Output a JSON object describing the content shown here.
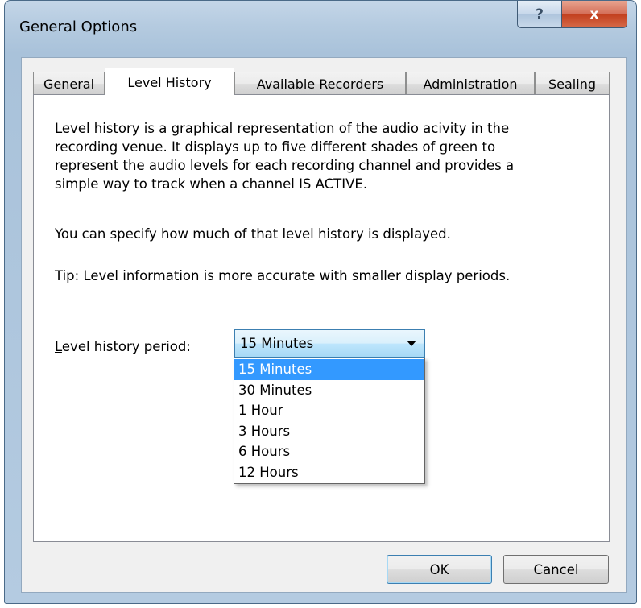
{
  "window": {
    "title": "General Options",
    "help_label": "?",
    "close_label": "x"
  },
  "tabs": [
    {
      "label": "General",
      "active": false
    },
    {
      "label": "Level History",
      "active": true
    },
    {
      "label": "Available Recorders",
      "active": false
    },
    {
      "label": "Administration",
      "active": false
    },
    {
      "label": "Sealing",
      "active": false
    }
  ],
  "panel": {
    "description_lines": [
      "Level history is a graphical representation of the audio acivity in the",
      "recording venue.  It displays up to five different shades of green to",
      "represent the audio levels for each recording channel and provides a",
      "simple way to track when a channel IS ACTIVE."
    ],
    "specify_text": "You can specify how much of that level history is displayed.",
    "tip_text": "Tip: Level information is more accurate with smaller display periods.",
    "period_label_mnemonic": "L",
    "period_label_rest": "evel history period:",
    "period_value": "15 Minutes",
    "period_options": [
      "15 Minutes",
      "30 Minutes",
      "1 Hour",
      "3 Hours",
      "6 Hours",
      "12 Hours"
    ],
    "selected_option_index": 0
  },
  "buttons": {
    "ok": "OK",
    "cancel": "Cancel"
  }
}
